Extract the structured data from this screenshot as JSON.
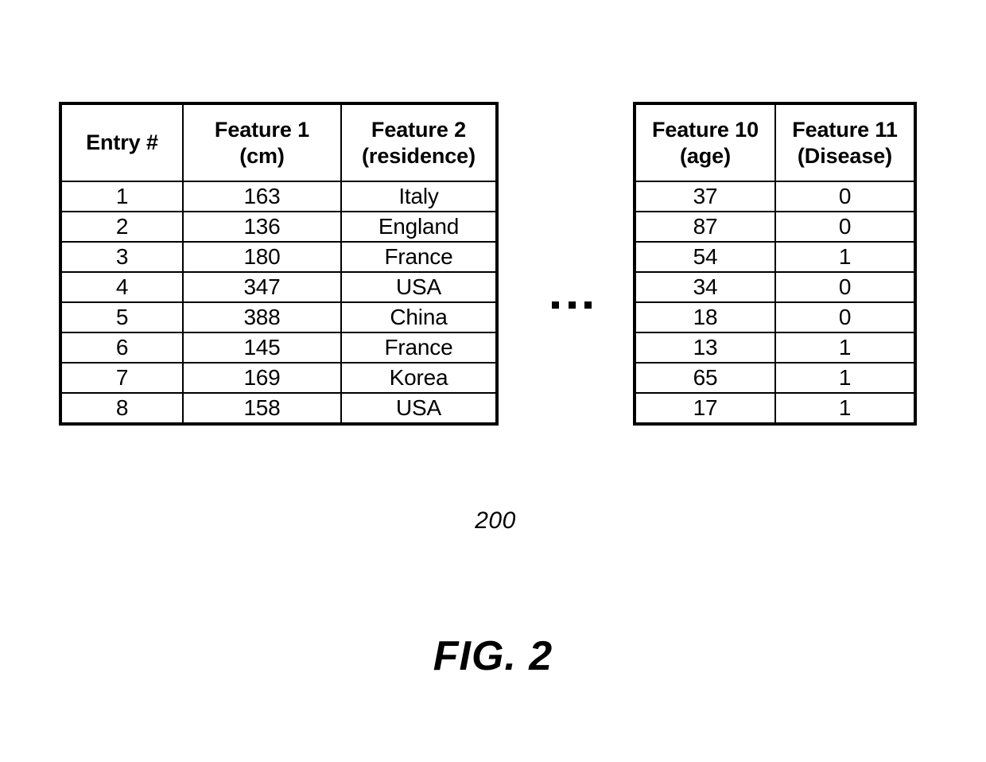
{
  "figure": {
    "caption": "FIG. 2",
    "reference_numeral": "200",
    "continuation_marker": "..."
  },
  "left_table": {
    "name": "feature-table-left",
    "headers": [
      {
        "line1": "Entry #",
        "line2": ""
      },
      {
        "line1": "Feature 1",
        "line2": "(cm)"
      },
      {
        "line1": "Feature 2",
        "line2": "(residence)"
      }
    ],
    "rows": [
      {
        "entry": "1",
        "feature1": "163",
        "feature2": "Italy"
      },
      {
        "entry": "2",
        "feature1": "136",
        "feature2": "England"
      },
      {
        "entry": "3",
        "feature1": "180",
        "feature2": "France"
      },
      {
        "entry": "4",
        "feature1": "347",
        "feature2": "USA"
      },
      {
        "entry": "5",
        "feature1": "388",
        "feature2": "China"
      },
      {
        "entry": "6",
        "feature1": "145",
        "feature2": "France"
      },
      {
        "entry": "7",
        "feature1": "169",
        "feature2": "Korea"
      },
      {
        "entry": "8",
        "feature1": "158",
        "feature2": "USA"
      }
    ]
  },
  "right_table": {
    "name": "feature-table-right",
    "headers": [
      {
        "line1": "Feature 10",
        "line2": "(age)"
      },
      {
        "line1": "Feature 11",
        "line2": "(Disease)"
      }
    ],
    "rows": [
      {
        "feature10": "37",
        "feature11": "0"
      },
      {
        "feature10": "87",
        "feature11": "0"
      },
      {
        "feature10": "54",
        "feature11": "1"
      },
      {
        "feature10": "34",
        "feature11": "0"
      },
      {
        "feature10": "18",
        "feature11": "0"
      },
      {
        "feature10": "13",
        "feature11": "1"
      },
      {
        "feature10": "65",
        "feature11": "1"
      },
      {
        "feature10": "17",
        "feature11": "1"
      }
    ]
  },
  "colors": {
    "ink": "#000000",
    "paper": "#ffffff"
  }
}
